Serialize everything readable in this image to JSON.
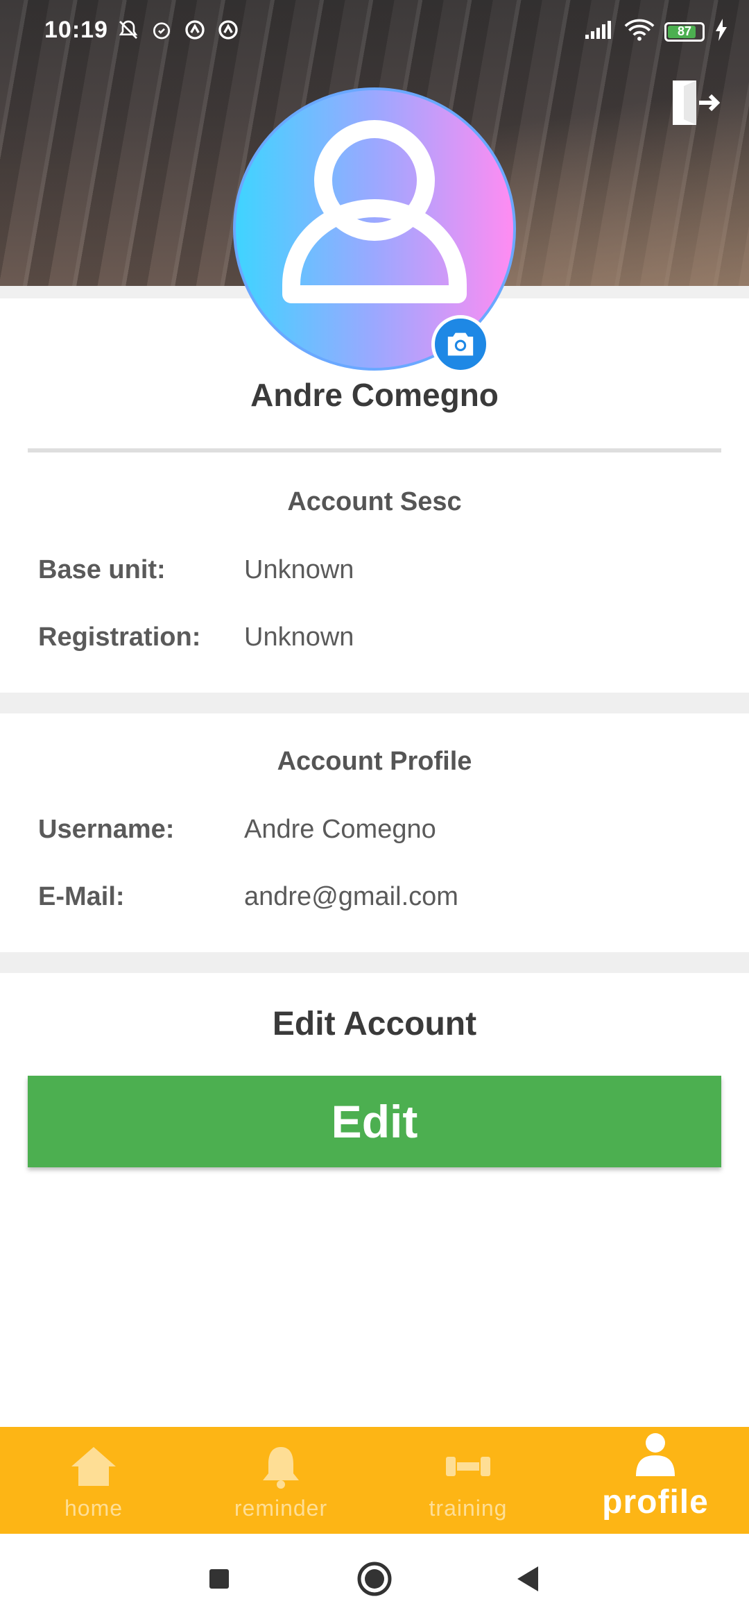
{
  "status_bar": {
    "time": "10:19",
    "battery_level": "87",
    "icons": [
      "bell-off-icon",
      "alarm-icon",
      "app-notification-icon",
      "app-notification-icon",
      "signal-icon",
      "wifi-icon",
      "battery-icon",
      "charging-icon"
    ]
  },
  "profile": {
    "name": "Andre Comegno"
  },
  "account_sesc": {
    "title": "Account Sesc",
    "rows": [
      {
        "label": "Base unit:",
        "value": "Unknown"
      },
      {
        "label": "Registration:",
        "value": "Unknown"
      }
    ]
  },
  "account_profile": {
    "title": "Account Profile",
    "rows": [
      {
        "label": "Username:",
        "value": "Andre Comegno"
      },
      {
        "label": "E-Mail:",
        "value": "andre@gmail.com"
      }
    ]
  },
  "edit_account": {
    "title": "Edit Account",
    "button_label": "Edit"
  },
  "bottom_nav": {
    "items": [
      {
        "label": "home",
        "icon": "home-icon"
      },
      {
        "label": "reminder",
        "icon": "bell-icon"
      },
      {
        "label": "training",
        "icon": "dumbbell-icon"
      },
      {
        "label": "profile",
        "icon": "person-icon",
        "active": true
      }
    ]
  },
  "colors": {
    "accent_nav": "#fdb515",
    "edit_button": "#4caf50",
    "camera_button": "#1e88e5"
  }
}
